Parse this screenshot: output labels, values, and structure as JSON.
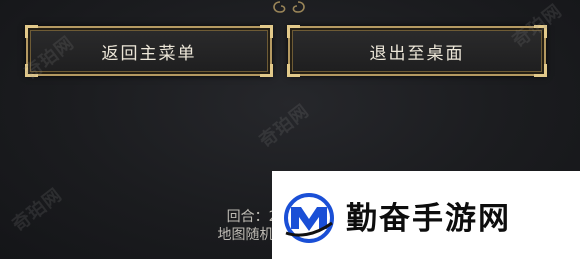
{
  "menu": {
    "return_main_menu": "返回主菜单",
    "exit_to_desktop": "退出至桌面"
  },
  "status": {
    "line1": "回合：22 ｜ 古",
    "line2": "地图随机种"
  },
  "watermarks": [
    "奇珀网",
    "奇珀网",
    "奇珀网",
    "奇珀网"
  ],
  "banner": {
    "text": "勤奋手游网"
  },
  "colors": {
    "gold_border": "#b59a62",
    "button_text": "#ece6d8",
    "logo_blue": "#1a4fd6"
  }
}
